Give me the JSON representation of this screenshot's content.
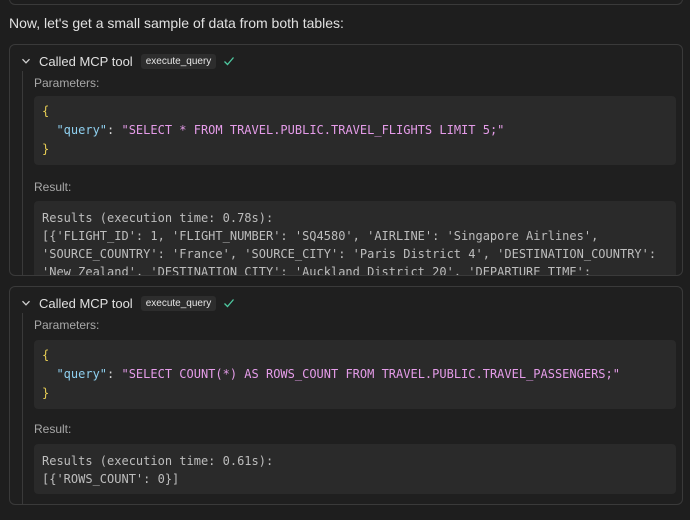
{
  "intro_text": "Now, let's get a small sample of data from both tables:",
  "colors": {
    "brace": "#e6cd54",
    "json_key": "#8fd0f0",
    "json_string": "#e59ce9",
    "check": "#4ec9a0"
  },
  "calls": [
    {
      "header_label": "Called MCP tool",
      "tool_name": "execute_query",
      "parameters_label": "Parameters:",
      "open_brace": "{",
      "close_brace": "}",
      "param_key": "\"query\"",
      "param_value": "\"SELECT * FROM TRAVEL.PUBLIC.TRAVEL_FLIGHTS LIMIT 5;\"",
      "result_label": "Result:",
      "result_lines": [
        "Results (execution time: 0.78s):",
        "[{'FLIGHT_ID': 1, 'FLIGHT_NUMBER': 'SQ4580', 'AIRLINE': 'Singapore Airlines',",
        "'SOURCE_COUNTRY': 'France', 'SOURCE_CITY': 'Paris District 4', 'DESTINATION_COUNTRY':",
        "'New Zealand', 'DESTINATION_CITY': 'Auckland District 20', 'DEPARTURE_TIME':"
      ]
    },
    {
      "header_label": "Called MCP tool",
      "tool_name": "execute_query",
      "parameters_label": "Parameters:",
      "open_brace": "{",
      "close_brace": "}",
      "param_key": "\"query\"",
      "param_value": "\"SELECT COUNT(*) AS ROWS_COUNT FROM TRAVEL.PUBLIC.TRAVEL_PASSENGERS;\"",
      "result_label": "Result:",
      "result_lines": [
        "Results (execution time: 0.61s):",
        "[{'ROWS_COUNT': 0}]"
      ]
    }
  ]
}
